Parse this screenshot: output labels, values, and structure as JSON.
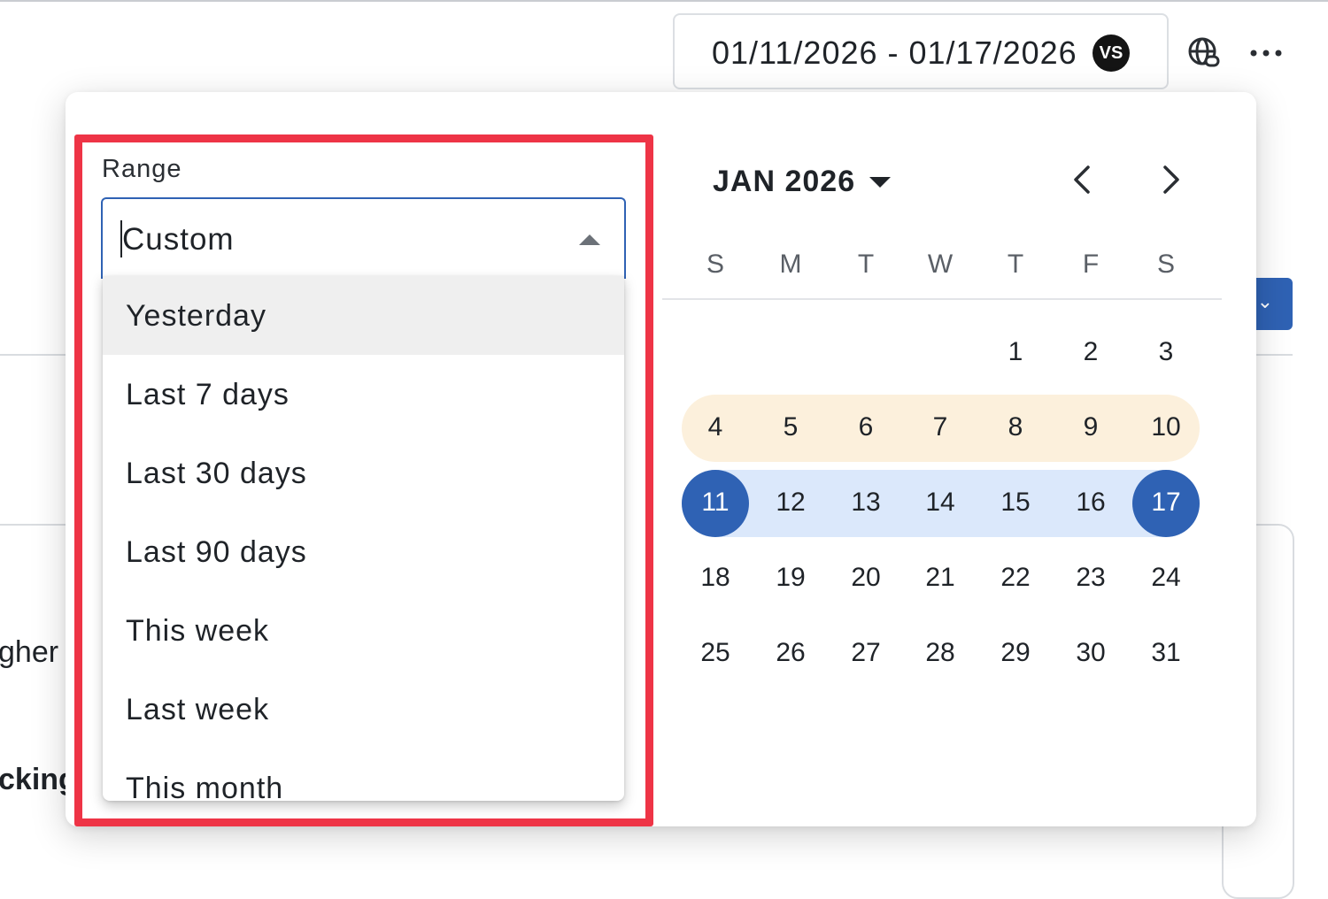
{
  "topbar": {
    "date_range": "01/11/2026 - 01/17/2026",
    "badge": "VS",
    "globe_icon": "globe-link-icon",
    "more_icon": "more-horizontal-icon"
  },
  "background": {
    "text_1": "gher",
    "text_2": "cking"
  },
  "range": {
    "label": "Range",
    "value": "Custom",
    "options": [
      "Yesterday",
      "Last 7 days",
      "Last 30 days",
      "Last 90 days",
      "This week",
      "Last week",
      "This month"
    ]
  },
  "calendar": {
    "month_label": "JAN 2026",
    "weekdays": [
      "S",
      "M",
      "T",
      "W",
      "T",
      "F",
      "S"
    ],
    "weeks": [
      [
        "",
        "",
        "",
        "",
        "1",
        "2",
        "3"
      ],
      [
        "4",
        "5",
        "6",
        "7",
        "8",
        "9",
        "10"
      ],
      [
        "11",
        "12",
        "13",
        "14",
        "15",
        "16",
        "17"
      ],
      [
        "18",
        "19",
        "20",
        "21",
        "22",
        "23",
        "24"
      ],
      [
        "25",
        "26",
        "27",
        "28",
        "29",
        "30",
        "31"
      ]
    ],
    "selected_start": "11",
    "selected_end": "17"
  },
  "colors": {
    "accent": "#2f62b4",
    "selected_range_bg": "#dbe8fb",
    "previous_week_bg": "#fcf0dc",
    "highlight_outline": "#ee3446"
  }
}
